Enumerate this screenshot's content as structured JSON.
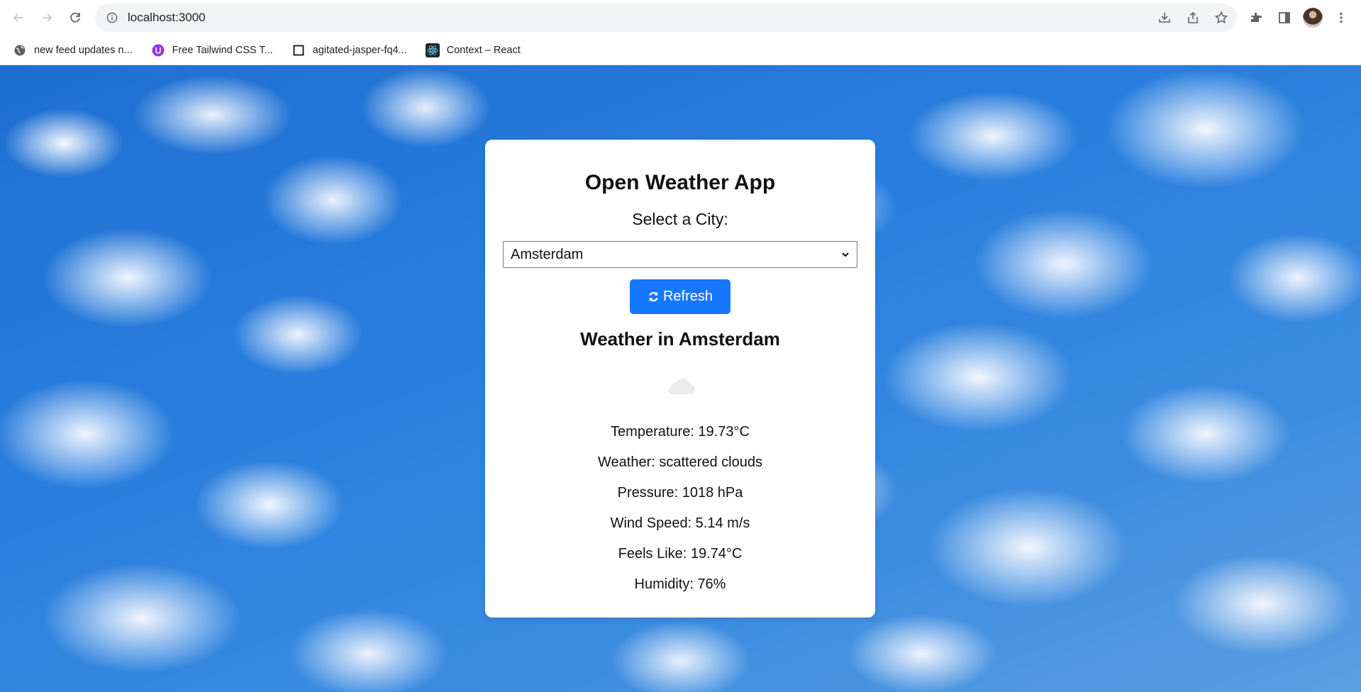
{
  "browser": {
    "url": "localhost:3000",
    "bookmarks": [
      {
        "label": "new feed updates n...",
        "icon": "globe-icon"
      },
      {
        "label": "Free Tailwind CSS T...",
        "icon": "tailwind-ui-icon"
      },
      {
        "label": "agitated-jasper-fq4...",
        "icon": "codesandbox-icon"
      },
      {
        "label": "Context – React",
        "icon": "react-icon"
      }
    ]
  },
  "app": {
    "title": "Open Weather App",
    "city_label": "Select a City:",
    "selected_city": "Amsterdam",
    "refresh_label": "Refresh",
    "weather_heading": "Weather in Amsterdam",
    "weather_icon": "cloud-icon",
    "stats": {
      "temperature": "Temperature: 19.73°C",
      "weather": "Weather: scattered clouds",
      "pressure": "Pressure: 1018 hPa",
      "wind_speed": "Wind Speed: 5.14 m/s",
      "feels_like": "Feels Like: 19.74°C",
      "humidity": "Humidity: 76%"
    }
  },
  "colors": {
    "accent": "#1677ff",
    "sky": "#2a7fde"
  }
}
